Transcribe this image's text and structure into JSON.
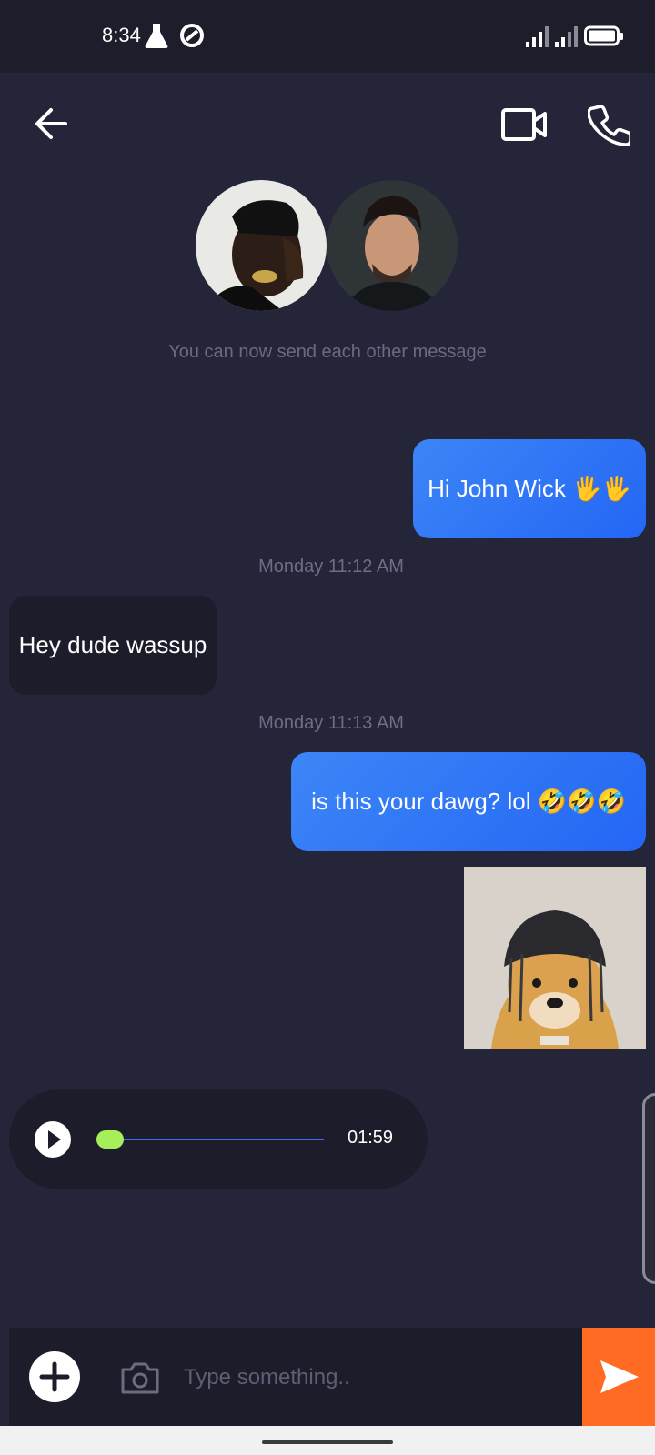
{
  "status_bar": {
    "time": "8:34"
  },
  "conversation": {
    "info_text": "You can now send each other message",
    "messages": [
      {
        "direction": "outgoing",
        "text": "Hi John Wick 🖐🖐"
      },
      {
        "type": "timestamp",
        "text": "Monday 11:12 AM"
      },
      {
        "direction": "incoming",
        "text": "Hey dude wassup"
      },
      {
        "type": "timestamp",
        "text": "Monday 11:13 AM"
      },
      {
        "direction": "outgoing",
        "text": "is this your dawg? lol 🤣🤣🤣"
      }
    ],
    "voice_note": {
      "duration": "01:59",
      "progress": 0.0
    }
  },
  "composer": {
    "placeholder": "Type something.."
  },
  "colors": {
    "background": "#25253a",
    "outgoing_bubble": "#2f74f6",
    "incoming_bubble": "#1c1c2b",
    "send_button": "#ff6b22",
    "progress_thumb": "#a7ef5a"
  },
  "icons": {
    "back": "arrow-left-icon",
    "video": "video-camera-icon",
    "call": "phone-icon",
    "add": "plus-icon",
    "camera": "camera-icon",
    "send": "send-icon",
    "play": "play-icon"
  }
}
